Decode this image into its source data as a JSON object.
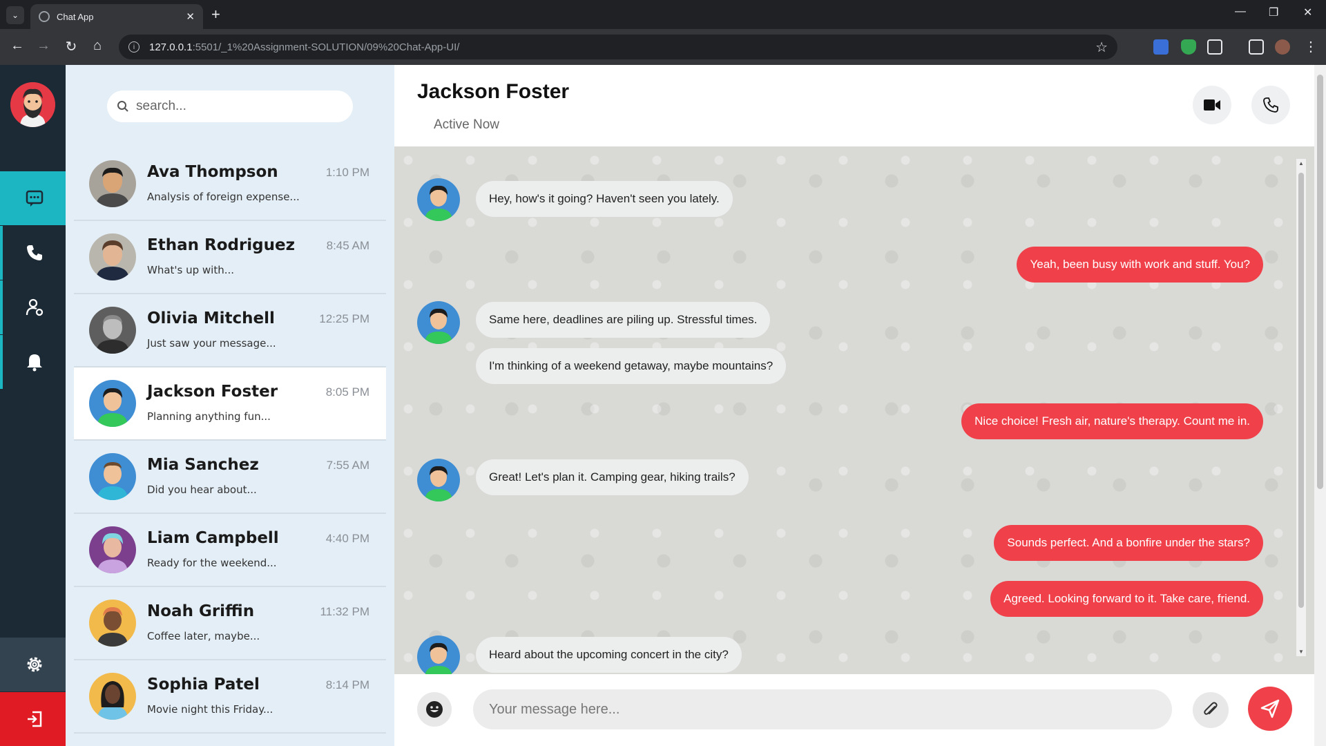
{
  "browser": {
    "tab_title": "Chat App",
    "url_host": "127.0.0.1",
    "url_rest": ":5501/_1%20Assignment-SOLUTION/09%20Chat-App-UI/"
  },
  "colors": {
    "accent": "#f0414a",
    "rail_bg": "#1c2a36",
    "rail_active": "#1bb6c1",
    "exit": "#e01b24"
  },
  "rail": {
    "items": [
      {
        "icon": "chat-icon"
      },
      {
        "icon": "phone-icon"
      },
      {
        "icon": "user-settings-icon"
      },
      {
        "icon": "bell-icon"
      },
      {
        "icon": "gear-icon"
      },
      {
        "icon": "logout-icon"
      }
    ]
  },
  "search": {
    "placeholder": "search..."
  },
  "chats": [
    {
      "name": "Ava Thompson",
      "time": "1:10 PM",
      "preview": "Analysis of foreign expense..."
    },
    {
      "name": "Ethan Rodriguez",
      "time": "8:45 AM",
      "preview": "What's up with..."
    },
    {
      "name": "Olivia Mitchell",
      "time": "12:25 PM",
      "preview": "Just saw your message..."
    },
    {
      "name": "Jackson Foster",
      "time": "8:05 PM",
      "preview": "Planning anything fun..."
    },
    {
      "name": "Mia Sanchez",
      "time": "7:55 AM",
      "preview": "Did you hear about..."
    },
    {
      "name": "Liam Campbell",
      "time": "4:40 PM",
      "preview": "Ready for the weekend..."
    },
    {
      "name": "Noah Griffin",
      "time": "11:32 PM",
      "preview": "Coffee later, maybe..."
    },
    {
      "name": "Sophia Patel",
      "time": "8:14 PM",
      "preview": "Movie night this Friday..."
    }
  ],
  "conversation": {
    "contact_name": "Jackson Foster",
    "status": "Active Now",
    "messages": [
      {
        "dir": "in",
        "text": "Hey, how's it going? Haven't seen you lately."
      },
      {
        "dir": "out",
        "text": "Yeah, been busy with work and stuff. You?"
      },
      {
        "dir": "in",
        "text": "Same here, deadlines are piling up. Stressful times."
      },
      {
        "dir": "in",
        "text": "I'm thinking of a weekend getaway, maybe mountains?"
      },
      {
        "dir": "out",
        "text": "Nice choice! Fresh air, nature's therapy. Count me in."
      },
      {
        "dir": "in",
        "text": "Great! Let's plan it. Camping gear, hiking trails?"
      },
      {
        "dir": "out",
        "text": "Sounds perfect. And a bonfire under the stars?"
      },
      {
        "dir": "out",
        "text": "Agreed. Looking forward to it. Take care, friend."
      },
      {
        "dir": "in",
        "text": "Heard about the upcoming concert in the city?"
      }
    ]
  },
  "composer": {
    "placeholder": "Your message here..."
  }
}
